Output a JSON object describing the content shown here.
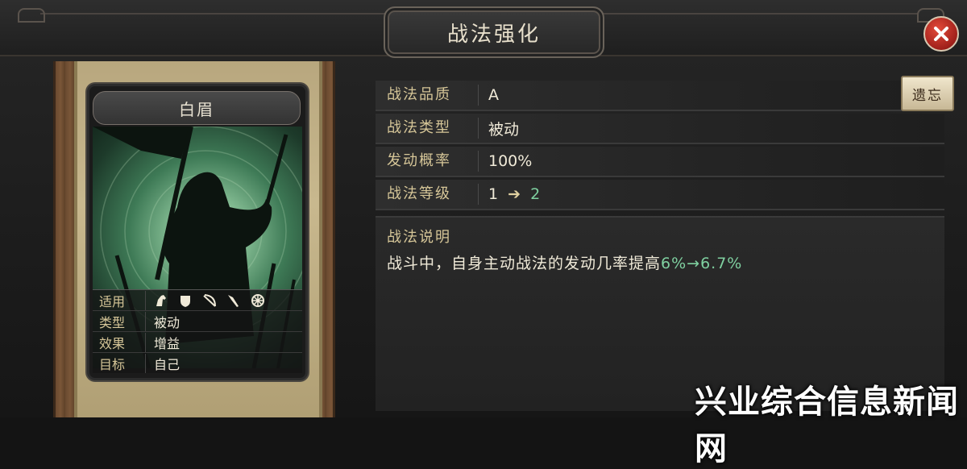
{
  "window": {
    "title": "战法强化"
  },
  "card": {
    "name": "白眉",
    "attributes": [
      {
        "key": "适用",
        "value": ""
      },
      {
        "key": "类型",
        "value": "被动"
      },
      {
        "key": "效果",
        "value": "增益"
      },
      {
        "key": "目标",
        "value": "自己"
      }
    ],
    "troop_icons": [
      "cavalry-icon",
      "shield-icon",
      "bow-icon",
      "spear-icon",
      "wheel-icon"
    ]
  },
  "info": {
    "quality": {
      "label": "战法品质",
      "value": "A"
    },
    "type": {
      "label": "战法类型",
      "value": "被动"
    },
    "rate": {
      "label": "发动概率",
      "value": "100%"
    },
    "level": {
      "label": "战法等级",
      "from": "1",
      "to": "2"
    }
  },
  "forget_button": {
    "label": "遗忘"
  },
  "description": {
    "title": "战法说明",
    "text": "战斗中，自身主动战法的发动几率提高",
    "highlight": "6%→6.7%"
  },
  "watermark": "兴业综合信息新闻网",
  "colors": {
    "accent_gold": "#d6c698",
    "highlight_green": "#7fd0a0",
    "close_red": "#c8302a"
  }
}
